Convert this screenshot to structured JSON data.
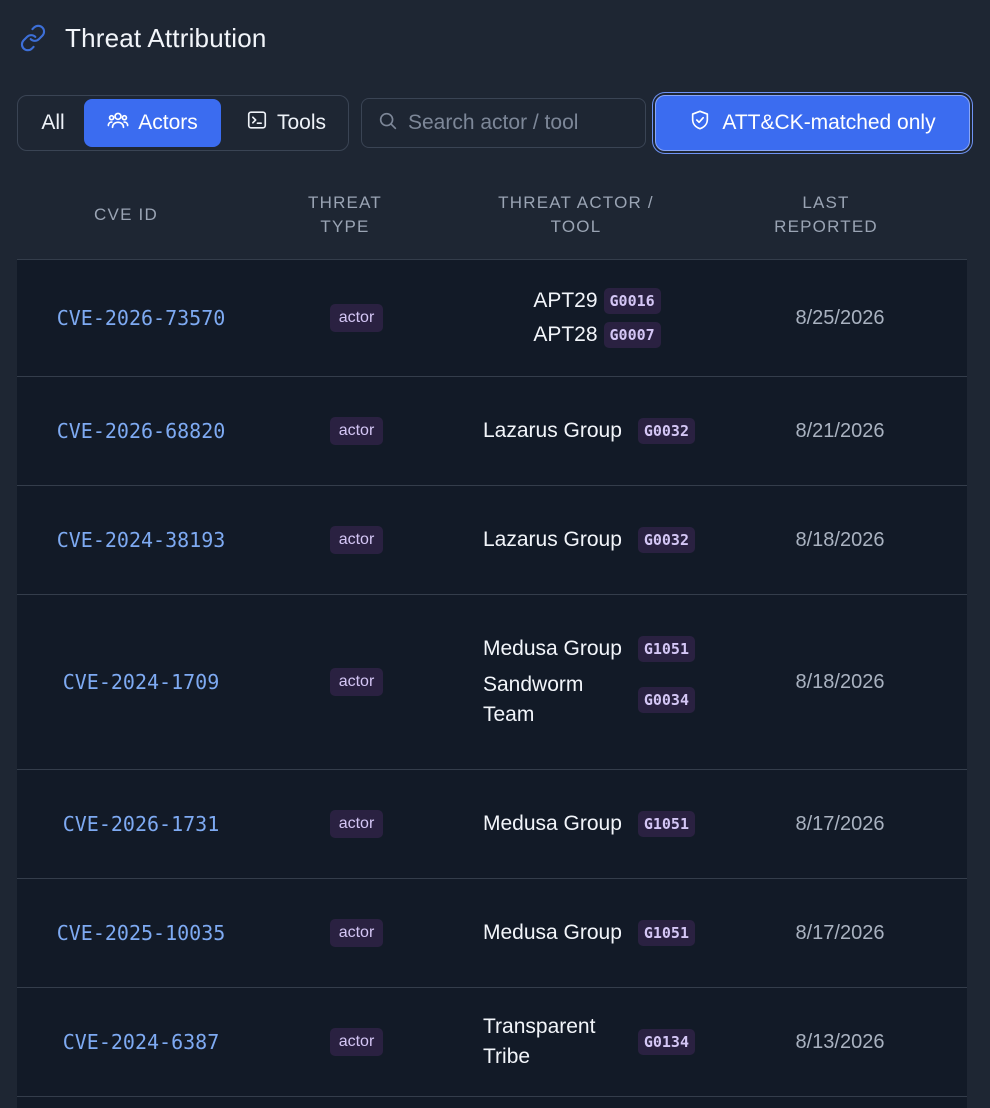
{
  "header": {
    "title": "Threat Attribution",
    "icon": "link-icon"
  },
  "toolbar": {
    "filters": [
      {
        "label": "All",
        "active": false
      },
      {
        "label": "Actors",
        "active": true,
        "icon": "users-icon"
      },
      {
        "label": "Tools",
        "active": false,
        "icon": "terminal-icon"
      }
    ],
    "search_placeholder": "Search actor / tool",
    "attck_label": "ATT&CK-matched only",
    "attck_icon": "shield-check-icon"
  },
  "columns": [
    "CVE ID",
    "THREAT TYPE",
    "THREAT ACTOR / TOOL",
    "LAST REPORTED"
  ],
  "rows": [
    {
      "cve": "CVE-2026-73570",
      "type": "actor",
      "actors": [
        {
          "name": "APT29",
          "id": "G0016"
        },
        {
          "name": "APT28",
          "id": "G0007"
        }
      ],
      "date": "8/25/2026"
    },
    {
      "cve": "CVE-2026-68820",
      "type": "actor",
      "actors": [
        {
          "name": "Lazarus Group",
          "id": "G0032"
        }
      ],
      "date": "8/21/2026"
    },
    {
      "cve": "CVE-2024-38193",
      "type": "actor",
      "actors": [
        {
          "name": "Lazarus Group",
          "id": "G0032"
        }
      ],
      "date": "8/18/2026"
    },
    {
      "cve": "CVE-2024-1709",
      "type": "actor",
      "actors": [
        {
          "name": "Medusa Group",
          "id": "G1051"
        },
        {
          "name": "Sandworm Team",
          "id": "G0034"
        }
      ],
      "date": "8/18/2026"
    },
    {
      "cve": "CVE-2026-1731",
      "type": "actor",
      "actors": [
        {
          "name": "Medusa Group",
          "id": "G1051"
        }
      ],
      "date": "8/17/2026"
    },
    {
      "cve": "CVE-2025-10035",
      "type": "actor",
      "actors": [
        {
          "name": "Medusa Group",
          "id": "G1051"
        }
      ],
      "date": "8/17/2026"
    },
    {
      "cve": "CVE-2024-6387",
      "type": "actor",
      "actors": [
        {
          "name": "Transparent Tribe",
          "id": "G0134"
        }
      ],
      "date": "8/13/2026"
    }
  ]
}
